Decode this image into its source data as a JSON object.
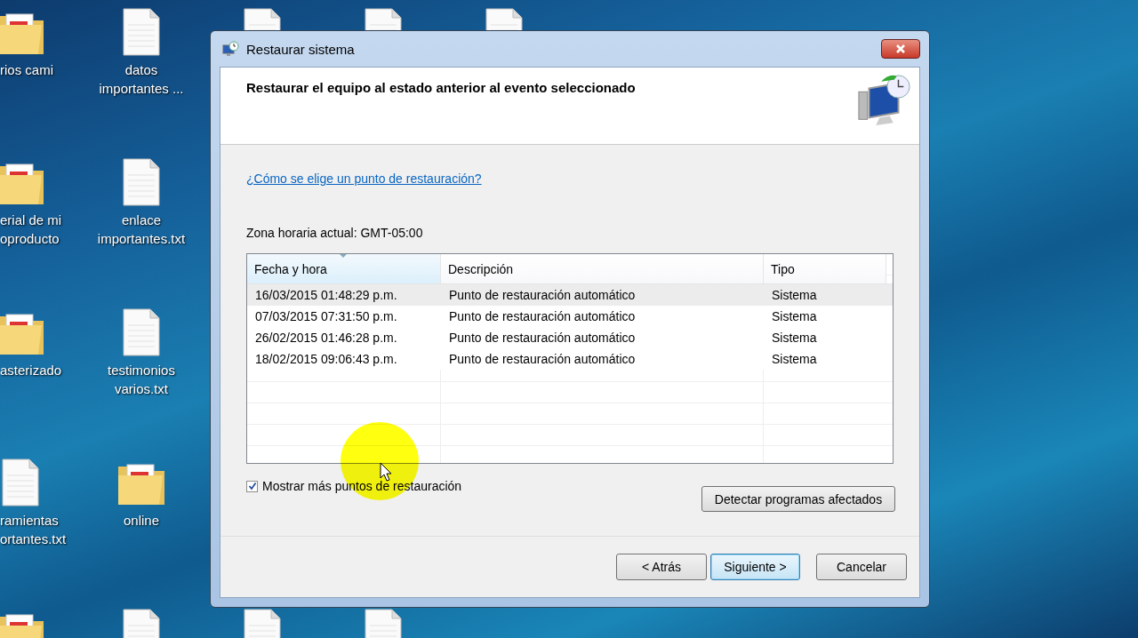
{
  "desktop": {
    "rows": [
      {
        "icons": [
          {
            "kind": "folder",
            "label": "rios cami"
          },
          {
            "kind": "document",
            "label": "datos importantes ..."
          },
          {
            "kind": "document"
          },
          {
            "kind": "document"
          },
          {
            "kind": "document"
          }
        ]
      },
      {
        "icons": [
          {
            "kind": "folder",
            "label": "erial de mi oproducto"
          },
          {
            "kind": "document",
            "label": "enlace importantes.txt"
          }
        ]
      },
      {
        "icons": [
          {
            "kind": "folder",
            "label": "asterizado"
          },
          {
            "kind": "document",
            "label": "testimonios varios.txt"
          }
        ]
      },
      {
        "icons": [
          {
            "kind": "document",
            "label": "ramientas ortantes.txt"
          },
          {
            "kind": "folder",
            "label": "online"
          }
        ]
      },
      {
        "icons": [
          {
            "kind": "folder"
          },
          {
            "kind": "document"
          },
          {
            "kind": "document"
          },
          {
            "kind": "document"
          }
        ]
      }
    ]
  },
  "window": {
    "title": "Restaurar sistema",
    "heading": "Restaurar el equipo al estado anterior al evento seleccionado"
  },
  "help_link": "¿Cómo se elige un punto de restauración?",
  "time_zone": "Zona horaria actual: GMT-05:00",
  "table": {
    "columns": [
      {
        "label": "Fecha y hora",
        "sorted": true
      },
      {
        "label": "Descripción",
        "sorted": false
      },
      {
        "label": "Tipo",
        "sorted": false
      }
    ],
    "rows": [
      {
        "cells": [
          "16/03/2015 01:48:29 p.m.",
          "Punto de restauración automático",
          "Sistema"
        ],
        "selected": true
      },
      {
        "cells": [
          "07/03/2015 07:31:50 p.m.",
          "Punto de restauración automático",
          "Sistema"
        ],
        "selected": false
      },
      {
        "cells": [
          "26/02/2015 01:46:28 p.m.",
          "Punto de restauración automático",
          "Sistema"
        ],
        "selected": false
      },
      {
        "cells": [
          "18/02/2015 09:06:43 p.m.",
          "Punto de restauración automático",
          "Sistema"
        ],
        "selected": false
      }
    ]
  },
  "show_more": {
    "label": "Mostrar más puntos de restauración",
    "checked": true
  },
  "detect_button": "Detectar programas afectados",
  "buttons": [
    {
      "label": "< Atrás",
      "default": false
    },
    {
      "label": "Siguiente >",
      "default": true
    },
    {
      "label": "Cancelar",
      "default": false
    }
  ]
}
